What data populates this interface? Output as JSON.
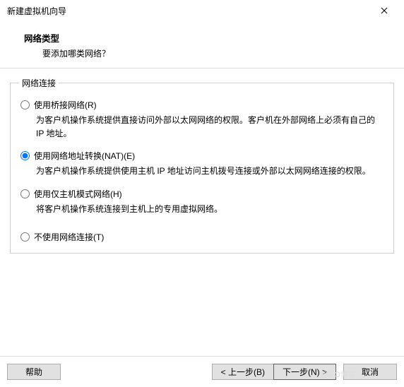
{
  "window": {
    "title": "新建虚拟机向导"
  },
  "header": {
    "title": "网络类型",
    "subtitle": "要添加哪类网络？"
  },
  "group": {
    "legend": "网络连接",
    "options": [
      {
        "label": "使用桥接网络(R)",
        "desc": "为客户机操作系统提供直接访问外部以太网网络的权限。客户机在外部网络上必须有自己的 IP 地址。",
        "selected": false
      },
      {
        "label": "使用网络地址转换(NAT)(E)",
        "desc": "为客户机操作系统提供使用主机 IP 地址访问主机拨号连接或外部以太网网络连接的权限。",
        "selected": true
      },
      {
        "label": "使用仅主机模式网络(H)",
        "desc": "将客户机操作系统连接到主机上的专用虚拟网络。",
        "selected": false
      },
      {
        "label": "不使用网络连接(T)",
        "desc": "",
        "selected": false
      }
    ]
  },
  "buttons": {
    "help": "帮助",
    "back": "< 上一步(B)",
    "next": "下一步(N) >",
    "cancel": "取消"
  },
  "watermark": "@5 O博客"
}
